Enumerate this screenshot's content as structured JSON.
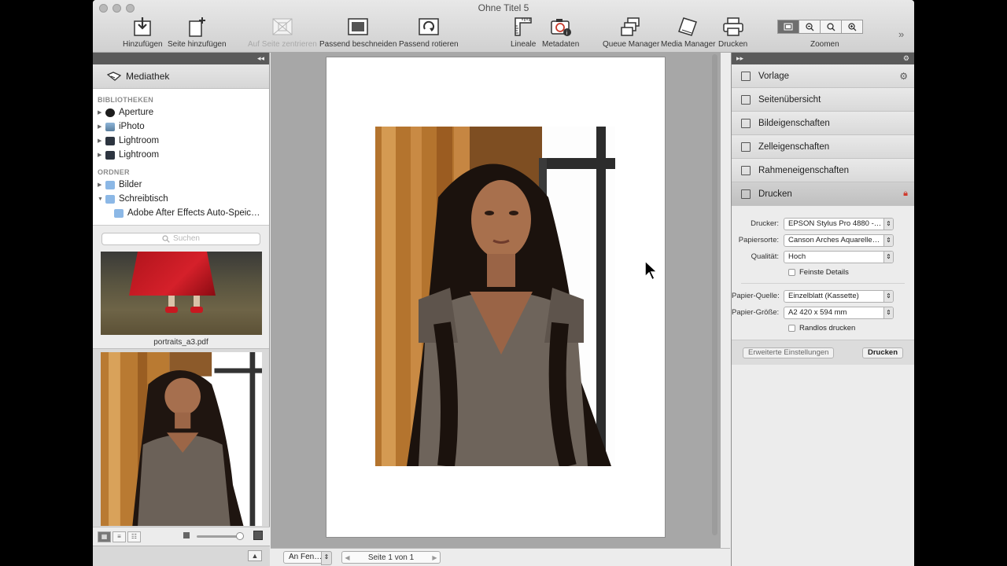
{
  "window": {
    "title": "Ohne Titel 5"
  },
  "toolbar": {
    "buttons": [
      {
        "label": "Hinzufügen",
        "icon": "add-icon"
      },
      {
        "label": "Seite hinzufügen",
        "icon": "add-page-icon"
      },
      {
        "label": "Auf Seite zentrieren",
        "icon": "center-icon",
        "disabled": true
      },
      {
        "label": "Passend beschneiden",
        "icon": "crop-icon"
      },
      {
        "label": "Passend rotieren",
        "icon": "rotate-icon"
      },
      {
        "label": "Lineale",
        "icon": "ruler-icon"
      },
      {
        "label": "Metadaten",
        "icon": "camera-info-icon"
      },
      {
        "label": "Queue Manager",
        "icon": "queue-icon"
      },
      {
        "label": "Media Manager",
        "icon": "media-icon"
      },
      {
        "label": "Drucken",
        "icon": "printer-icon"
      }
    ],
    "zoom_label": "Zoomen"
  },
  "left": {
    "collapse": "◂◂",
    "library_title": "Mediathek",
    "sections": [
      {
        "title": "BIBLIOTHEKEN",
        "items": [
          "Aperture",
          "iPhoto",
          "Lightroom",
          "Lightroom"
        ]
      },
      {
        "title": "ORDNER",
        "items": [
          "Bilder",
          "Schreibtisch"
        ]
      }
    ],
    "subfolder": "Adobe After Effects Auto-Speic…",
    "search_placeholder": "Suchen",
    "thumb_caption": "portraits_a3.pdf"
  },
  "canvas": {
    "fit_select": "An Fen…",
    "page_label": "Seite 1 von 1"
  },
  "right": {
    "collapse": "▸▸",
    "items": [
      "Vorlage",
      "Seitenübersicht",
      "Bildeigenschaften",
      "Zelleigenschaften",
      "Rahmeneigenschaften",
      "Drucken"
    ],
    "form": {
      "printer_label": "Drucker:",
      "printer_value": "EPSON Stylus Pro 4880 -…",
      "paper_type_label": "Papiersorte:",
      "paper_type_value": "Canson Arches Aquarelle…",
      "quality_label": "Qualität:",
      "quality_value": "Hoch",
      "finest_details": "Feinste Details",
      "source_label": "Papier-Quelle:",
      "source_value": "Einzelblatt (Kassette)",
      "size_label": "Papier-Größe:",
      "size_value": "A2 420 x 594 mm",
      "borderless": "Randlos drucken",
      "advanced_button": "Erweiterte Einstellungen",
      "print_button": "Drucken"
    }
  }
}
